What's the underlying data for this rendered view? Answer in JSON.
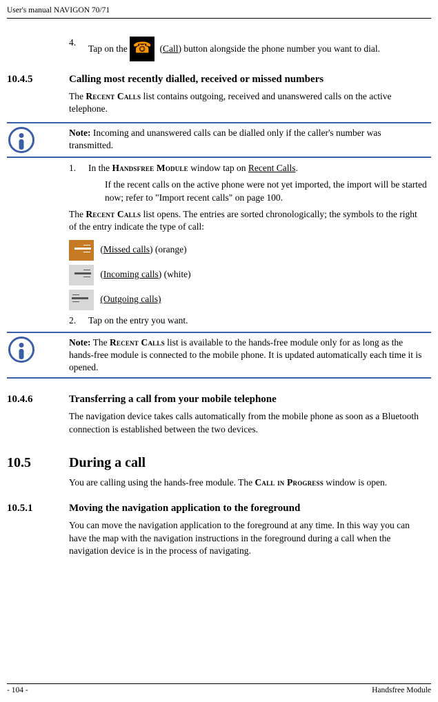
{
  "header": {
    "title": "User's manual NAVIGON 70/71"
  },
  "s1": {
    "step4_a": "Tap on the ",
    "step4_call": "Call",
    "step4_b": ") button alongside the phone number you want to dial.",
    "num4": "4."
  },
  "s1045": {
    "num": "10.4.5",
    "title": "Calling most recently dialled, received or missed numbers",
    "p1a": "The ",
    "recent": "Recent Calls",
    "p1b": " list contains outgoing, received and unanswered calls on the active telephone."
  },
  "note1": {
    "label": "Note:",
    "text": " Incoming and unanswered calls can be dialled only if the caller's number was transmitted."
  },
  "steps1045": {
    "n1": "1.",
    "t1a": "In the ",
    "hf": "Handsfree Module",
    "t1b": " window tap on ",
    "rc": "Recent Calls",
    "t1c": ".",
    "sub": "If the recent calls on the active phone were not yet imported, the import will be started now; refer to \"Import recent calls\" on page 100.",
    "p2a": "The ",
    "p2b": " list opens. The entries are sorted chronologically; the symbols to the right of the entry indicate the type of call:",
    "missed": "Missed calls",
    "missed_sfx": " (orange)",
    "incoming": "Incoming calls",
    "incoming_sfx": " (white)",
    "outgoing": " (Outgoing calls)",
    "n2": "2.",
    "t2": "Tap on the entry you want."
  },
  "note2": {
    "label": "Note:",
    "a": " The ",
    "b": " list is available to the hands-free module only for as long as the hands-free module is connected to the mobile phone. It is updated automatically each time it is opened."
  },
  "s1046": {
    "num": "10.4.6",
    "title": "Transferring a call from your mobile telephone",
    "p": "The navigation device takes calls automatically from the mobile phone as soon as a Bluetooth connection is established between the two devices."
  },
  "s105": {
    "num": "10.5",
    "title": "During a call",
    "p_a": "You are calling using the hands-free module. The ",
    "cip": "Call in Progress",
    "p_b": " window is open."
  },
  "s1051": {
    "num": "10.5.1",
    "title": "Moving the navigation application to the foreground",
    "p1": "You can move the navigation application to the foreground at any time. In this way you can have the map with the navigation instructions in the foreground during a call when the navigation device is in the process of navigating."
  },
  "footer": {
    "left": "- 104 -",
    "right": "Handsfree Module"
  }
}
